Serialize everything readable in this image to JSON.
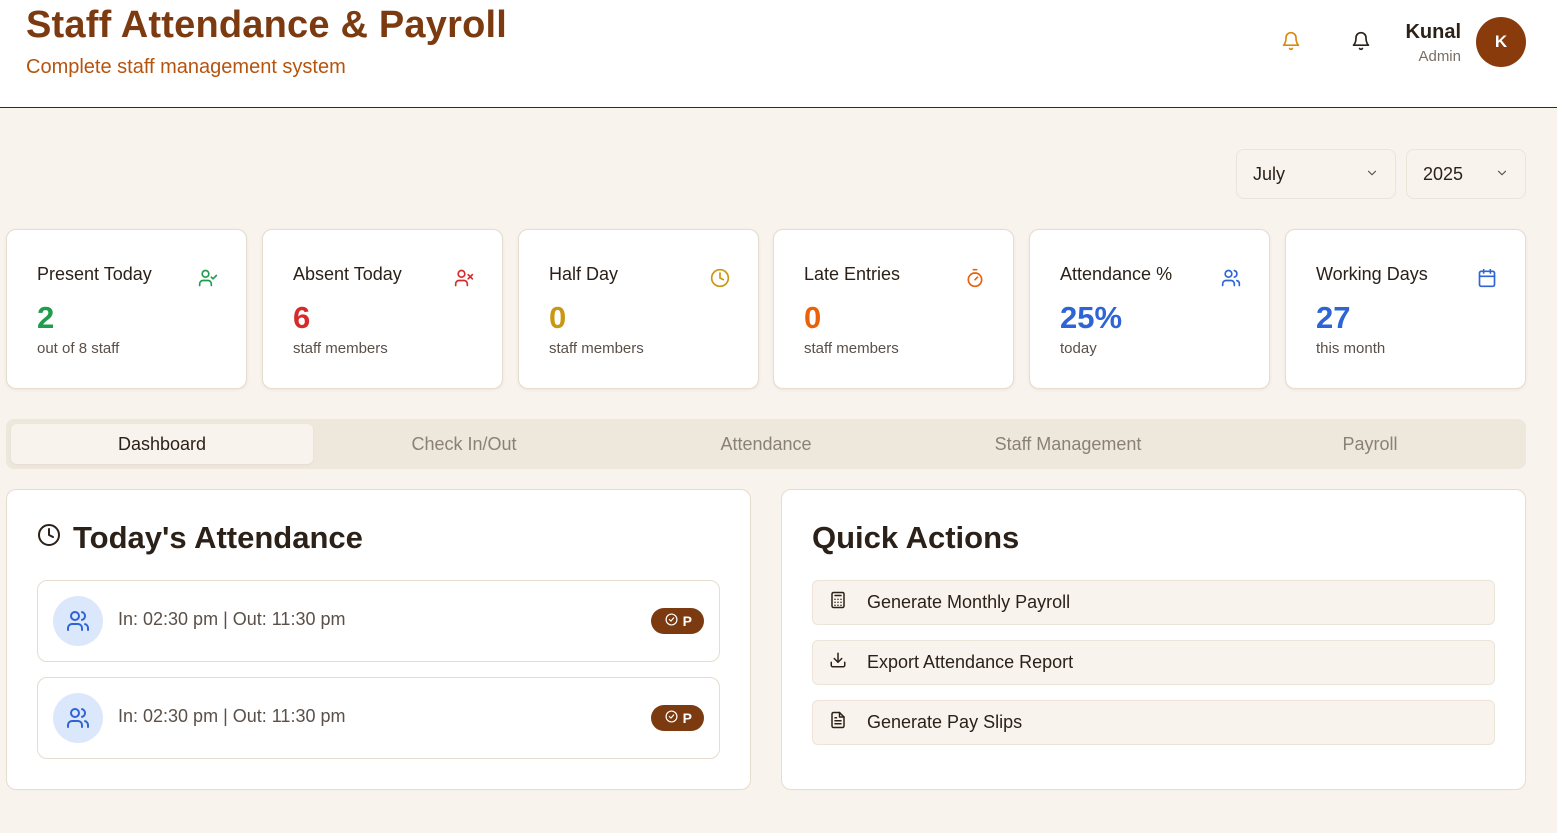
{
  "header": {
    "title": "Staff Attendance & Payroll",
    "subtitle": "Complete staff management system",
    "user": {
      "name": "Kunal",
      "role": "Admin",
      "initial": "K"
    },
    "icons": [
      "bell-icon",
      "bell-icon"
    ]
  },
  "filters": {
    "month": "July",
    "year": "2025"
  },
  "stats": [
    {
      "label": "Present Today",
      "value": "2",
      "sub": "out of 8 staff",
      "color": "#1f9d4c",
      "icon": "user-check-icon"
    },
    {
      "label": "Absent Today",
      "value": "6",
      "sub": "staff members",
      "color": "#d62b2b",
      "icon": "user-x-icon"
    },
    {
      "label": "Half Day",
      "value": "0",
      "sub": "staff members",
      "color": "#c99710",
      "icon": "clock-icon"
    },
    {
      "label": "Late Entries",
      "value": "0",
      "sub": "staff members",
      "color": "#e8620c",
      "icon": "timer-icon"
    },
    {
      "label": "Attendance %",
      "value": "25%",
      "sub": "today",
      "color": "#2f64d6",
      "icon": "users-icon"
    },
    {
      "label": "Working Days",
      "value": "27",
      "sub": "this month",
      "color": "#2f64d6",
      "icon": "calendar-icon"
    }
  ],
  "tabs": [
    {
      "label": "Dashboard",
      "active": true
    },
    {
      "label": "Check In/Out",
      "active": false
    },
    {
      "label": "Attendance",
      "active": false
    },
    {
      "label": "Staff Management",
      "active": false
    },
    {
      "label": "Payroll",
      "active": false
    }
  ],
  "todays_attendance": {
    "title": "Today's Attendance",
    "rows": [
      {
        "time": "In: 02:30 pm | Out: 11:30 pm",
        "status": "P"
      },
      {
        "time": "In: 02:30 pm | Out: 11:30 pm",
        "status": "P"
      }
    ]
  },
  "quick_actions": {
    "title": "Quick Actions",
    "items": [
      {
        "label": "Generate Monthly Payroll",
        "icon": "calculator-icon"
      },
      {
        "label": "Export Attendance Report",
        "icon": "download-icon"
      },
      {
        "label": "Generate Pay Slips",
        "icon": "file-text-icon"
      }
    ]
  },
  "colors": {
    "brand": "#7c3a10",
    "accent": "#b5540f",
    "background": "#f8f3ec"
  }
}
